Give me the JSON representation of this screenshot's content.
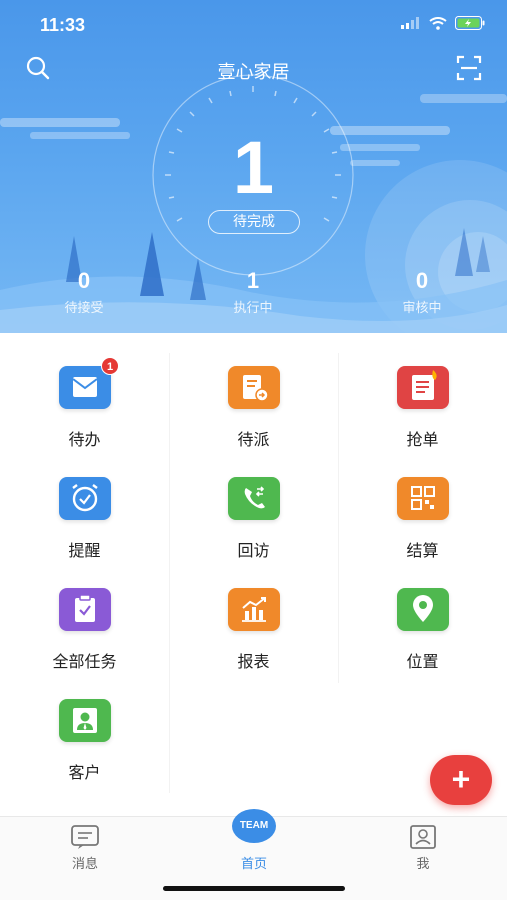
{
  "status_bar": {
    "time": "11:33"
  },
  "header": {
    "title": "壹心家居",
    "pending_count": "1",
    "pending_label": "待完成"
  },
  "stats": [
    {
      "value": "0",
      "label": "待接受"
    },
    {
      "value": "1",
      "label": "执行中"
    },
    {
      "value": "0",
      "label": "审核中"
    }
  ],
  "menu": [
    {
      "label": "待办",
      "icon": "mail-icon",
      "color": "#3b8de6",
      "badge": "1"
    },
    {
      "label": "待派",
      "icon": "dispatch-icon",
      "color": "#f0892a"
    },
    {
      "label": "抢单",
      "icon": "grab-order-icon",
      "color": "#e04444"
    },
    {
      "label": "提醒",
      "icon": "alarm-clock-icon",
      "color": "#3b8de6"
    },
    {
      "label": "回访",
      "icon": "phone-call-icon",
      "color": "#4fb84f"
    },
    {
      "label": "结算",
      "icon": "qr-settle-icon",
      "color": "#f0892a"
    },
    {
      "label": "全部任务",
      "icon": "clipboard-check-icon",
      "color": "#8a5ad6"
    },
    {
      "label": "报表",
      "icon": "chart-report-icon",
      "color": "#f0892a"
    },
    {
      "label": "位置",
      "icon": "location-pin-icon",
      "color": "#4fb84f"
    },
    {
      "label": "客户",
      "icon": "customer-icon",
      "color": "#4fb84f"
    }
  ],
  "fab": {
    "label": "+"
  },
  "tabbar": {
    "messages_label": "消息",
    "team_label": "TEAM",
    "home_label": "首页",
    "me_label": "我"
  }
}
